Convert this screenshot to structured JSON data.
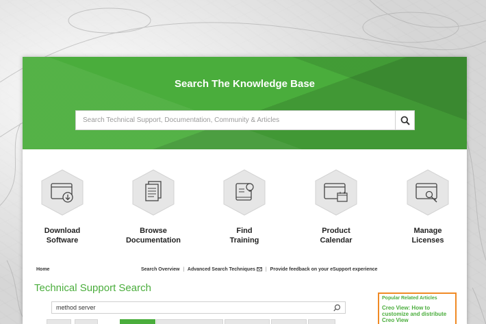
{
  "hero": {
    "title": "Search The Knowledge Base",
    "search_placeholder": "Search Technical Support, Documentation, Community & Articles",
    "search_button_icon": "search-icon"
  },
  "tiles": [
    {
      "line1": "Download",
      "line2": "Software",
      "icon": "download-window-icon"
    },
    {
      "line1": "Browse",
      "line2": "Documentation",
      "icon": "documents-icon"
    },
    {
      "line1": "Find",
      "line2": "Training",
      "icon": "book-lightbulb-icon"
    },
    {
      "line1": "Product",
      "line2": "Calendar",
      "icon": "calendar-window-icon"
    },
    {
      "line1": "Manage",
      "line2": "Licenses",
      "icon": "key-window-icon"
    }
  ],
  "breadcrumb": {
    "home": "Home",
    "search_overview": "Search Overview",
    "advanced": "Advanced Search Techniques",
    "feedback": "Provide feedback on your eSupport experience",
    "separator": "|"
  },
  "tech_search": {
    "title": "Technical Support Search",
    "query": "method server"
  },
  "related": {
    "heading": "Popular Related Articles",
    "link": "Creo View: How to customize and distribute Creo View"
  },
  "colors": {
    "brand_green": "#4aad3c",
    "accent_orange": "#f08a24"
  }
}
